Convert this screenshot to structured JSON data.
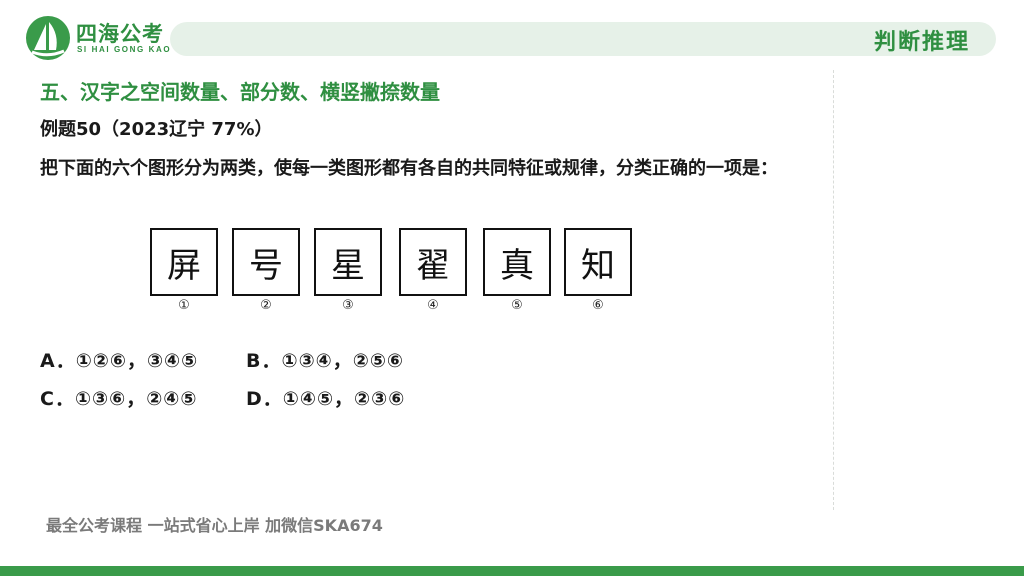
{
  "brand": {
    "name": "四海公考",
    "subtitle": "SI HAI GONG KAO",
    "logo_icon": "sail-icon",
    "accent_color": "#3a9b4a"
  },
  "section_tag": "判断推理",
  "heading": "五、汉字之空间数量、部分数、横竖撇捺数量",
  "question": {
    "label": "例题50（2023辽宁  77%）",
    "text": "把下面的六个图形分为两类，使每一类图形都有各自的共同特征或规律，分类正确的一项是："
  },
  "figures": [
    {
      "char": "屏",
      "num": "①"
    },
    {
      "char": "号",
      "num": "②"
    },
    {
      "char": "星",
      "num": "③"
    },
    {
      "char": "翟",
      "num": "④"
    },
    {
      "char": "真",
      "num": "⑤"
    },
    {
      "char": "知",
      "num": "⑥"
    }
  ],
  "options": {
    "a": "A．①②⑥，③④⑤",
    "b": "B．①③④，②⑤⑥",
    "c": "C．①③⑥，②④⑤",
    "d": "D．①④⑤，②③⑥"
  },
  "footer_note": "最全公考课程 一站式省心上岸 加微信SKA674"
}
